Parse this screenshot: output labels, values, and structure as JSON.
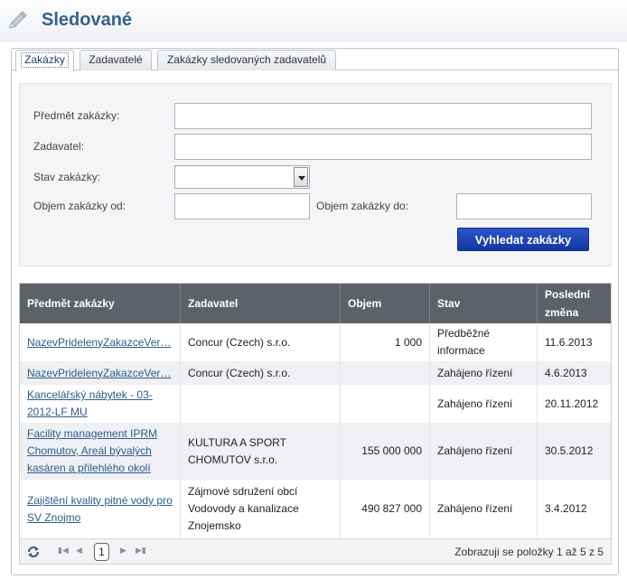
{
  "page": {
    "title": "Sledované"
  },
  "tabs": [
    {
      "label": "Zakázky"
    },
    {
      "label": "Zadavatelé"
    },
    {
      "label": "Zakázky sledovaných zadavatelů"
    }
  ],
  "search": {
    "subject_label": "Předmět zakázky:",
    "subject_value": "",
    "contractor_label": "Zadavatel:",
    "contractor_value": "",
    "state_label": "Stav zakázky:",
    "state_value": "",
    "volume_from_label": "Objem zakázky od:",
    "volume_from_value": "",
    "volume_to_label": "Objem zakázky do:",
    "volume_to_value": "",
    "submit_label": "Vyhledat zakázky"
  },
  "grid": {
    "columns": [
      "Předmět zakázky",
      "Zadavatel",
      "Objem",
      "Stav",
      "Poslední změna"
    ],
    "rows": [
      {
        "subject": "NazevPridelenyZakazceVer…",
        "contractor": "Concur (Czech) s.r.o.",
        "volume": "1 000",
        "state": "Předběžné informace",
        "changed": "11.6.2013"
      },
      {
        "subject": "NazevPridelenyZakazceVer…",
        "contractor": "Concur (Czech) s.r.o.",
        "volume": "",
        "state": "Zahájeno řízení",
        "changed": "4.6.2013"
      },
      {
        "subject": "Kancelářský nábytek - 03-2012-LF MU",
        "contractor": "",
        "volume": "",
        "state": "Zahájeno řízení",
        "changed": "20.11.2012"
      },
      {
        "subject": "Facility management IPRM Chomutov, Areál bývalých kasáren a přilehlého okolí",
        "contractor": "KULTURA A SPORT CHOMUTOV s.r.o.",
        "volume": "155 000 000",
        "state": "Zahájeno řízení",
        "changed": "30.5.2012"
      },
      {
        "subject": "Zajištění kvality pitné vody pro SV Znojmo",
        "contractor": "Zájmové sdružení obcí Vodovody a kanalizace Znojemsko",
        "volume": "490 827 000",
        "state": "Zahájeno řízení",
        "changed": "3.4.2012"
      }
    ]
  },
  "pager": {
    "current_page": "1",
    "info": "Zobrazuji se položky 1 až 5 z 5",
    "buttons": [
      "first-page-icon",
      "prev-page-icon",
      "next-page-icon",
      "last-page-icon",
      "refresh-icon"
    ]
  }
}
